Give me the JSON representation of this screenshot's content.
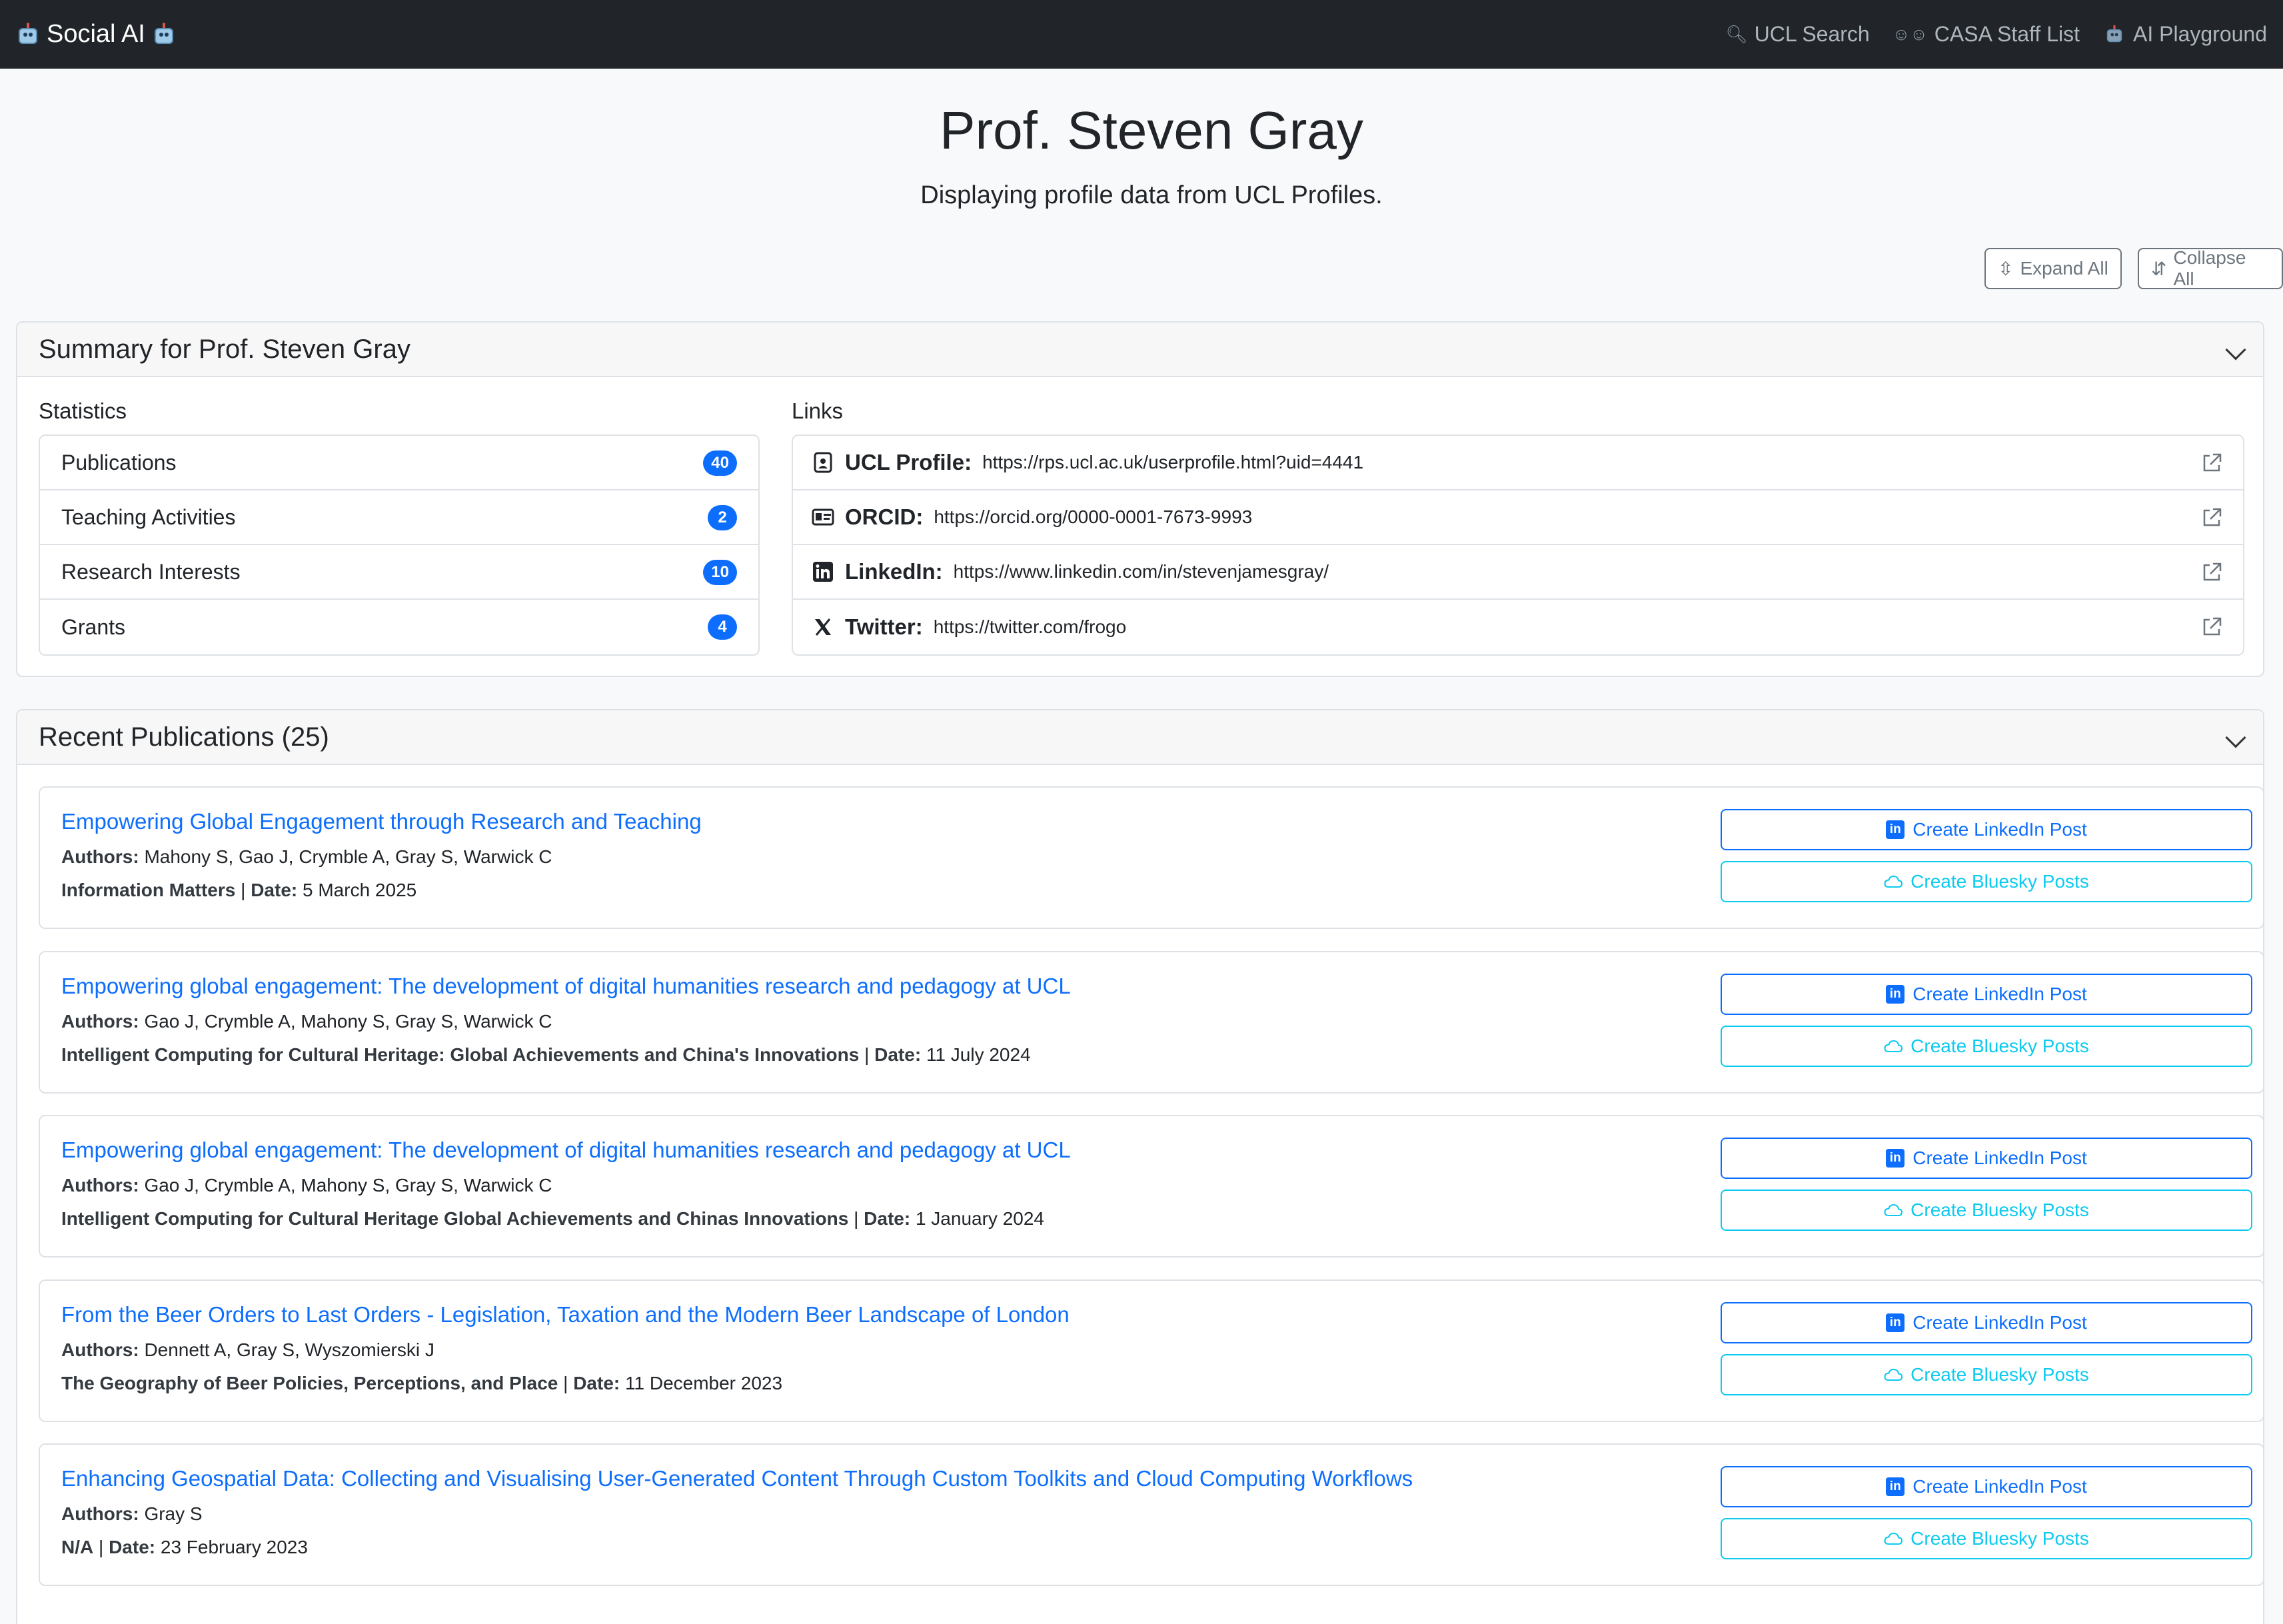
{
  "nav": {
    "brand": "Social AI",
    "links": [
      {
        "label": "UCL Search",
        "icon": "search-icon"
      },
      {
        "label": "CASA Staff List",
        "icon": "people-icon"
      },
      {
        "label": "AI Playground",
        "icon": "robot-icon"
      }
    ]
  },
  "header": {
    "title": "Prof. Steven Gray",
    "subtitle": "Displaying profile data from UCL Profiles."
  },
  "controls": {
    "expand_all": "Expand All",
    "collapse_all": "Collapse All"
  },
  "summary": {
    "title": "Summary for Prof. Steven Gray",
    "statistics_label": "Statistics",
    "links_label": "Links",
    "stats": [
      {
        "label": "Publications",
        "count": "40"
      },
      {
        "label": "Teaching Activities",
        "count": "2"
      },
      {
        "label": "Research Interests",
        "count": "10"
      },
      {
        "label": "Grants",
        "count": "4"
      }
    ],
    "links": [
      {
        "label": "UCL Profile:",
        "url": "https://rps.ucl.ac.uk/userprofile.html?uid=4441",
        "icon": "id-badge-icon"
      },
      {
        "label": "ORCID:",
        "url": "https://orcid.org/0000-0001-7673-9993",
        "icon": "id-card-icon"
      },
      {
        "label": "LinkedIn:",
        "url": "https://www.linkedin.com/in/stevenjamesgray/",
        "icon": "linkedin-icon"
      },
      {
        "label": "Twitter:",
        "url": "https://twitter.com/frogo",
        "icon": "x-icon"
      }
    ]
  },
  "publications": {
    "title": "Recent Publications (25)",
    "authors_label": "Authors:",
    "date_label": "Date:",
    "linkedin_btn": "Create LinkedIn Post",
    "bluesky_btn": "Create Bluesky Posts",
    "items": [
      {
        "title": "Empowering Global Engagement through Research and Teaching",
        "authors": "Mahony S, Gao J, Crymble A, Gray S, Warwick C",
        "venue": "Information Matters",
        "date": "5 March 2025"
      },
      {
        "title": "Empowering global engagement: The development of digital humanities research and pedagogy at UCL",
        "authors": "Gao J, Crymble A, Mahony S, Gray S, Warwick C",
        "venue": "Intelligent Computing for Cultural Heritage: Global Achievements and China's Innovations",
        "date": "11 July 2024"
      },
      {
        "title": "Empowering global engagement: The development of digital humanities research and pedagogy at UCL",
        "authors": "Gao J, Crymble A, Mahony S, Gray S, Warwick C",
        "venue": "Intelligent Computing for Cultural Heritage Global Achievements and Chinas Innovations",
        "date": "1 January 2024"
      },
      {
        "title": "From the Beer Orders to Last Orders - Legislation, Taxation and the Modern Beer Landscape of London",
        "authors": "Dennett A, Gray S, Wyszomierski J",
        "venue": "The Geography of Beer Policies, Perceptions, and Place",
        "date": "11 December 2023"
      },
      {
        "title": "Enhancing Geospatial Data: Collecting and Visualising User-Generated Content Through Custom Toolkits and Cloud Computing Workflows",
        "authors": "Gray S",
        "venue": "N/A",
        "date": "23 February 2023"
      }
    ]
  }
}
